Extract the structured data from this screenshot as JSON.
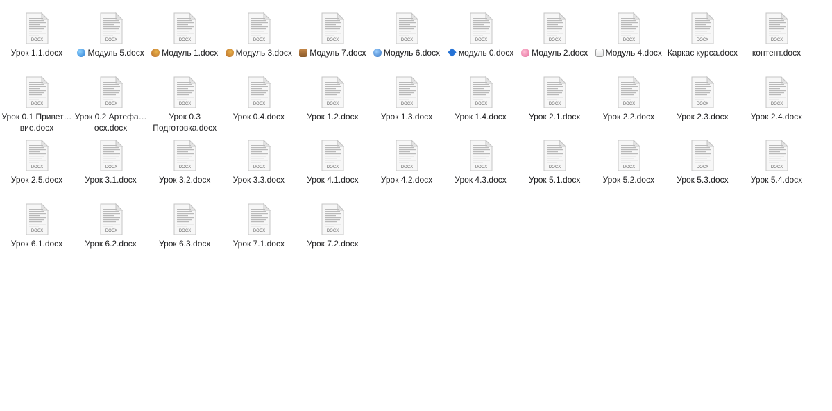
{
  "files": [
    {
      "name": "Урок 1.1.docx",
      "ext": "DOCX"
    },
    {
      "name": "Модуль 5.docx",
      "ext": "DOCX",
      "tag": "globe-icon"
    },
    {
      "name": "Модуль 1.docx",
      "ext": "DOCX",
      "tag": "palette-icon"
    },
    {
      "name": "Модуль 3.docx",
      "ext": "DOCX",
      "tag": "palette-icon"
    },
    {
      "name": "Модуль 7.docx",
      "ext": "DOCX",
      "tag": "box-icon"
    },
    {
      "name": "Модуль 6.docx",
      "ext": "DOCX",
      "tag": "refresh-icon"
    },
    {
      "name": "модуль 0.docx",
      "ext": "DOCX",
      "tag": "blue-diamond-icon"
    },
    {
      "name": "Модуль 2.docx",
      "ext": "DOCX",
      "tag": "brain-icon"
    },
    {
      "name": "Модуль 4.docx",
      "ext": "DOCX",
      "tag": "notepad-icon"
    },
    {
      "name": "Каркас курса.docx",
      "ext": "DOCX"
    },
    {
      "name": "контент.docx",
      "ext": "DOCX"
    },
    {
      "name": "Урок 0.1 Привет…вие.docx",
      "ext": "DOCX"
    },
    {
      "name": "Урок 0.2 Артефа…осх.docx",
      "ext": "DOCX"
    },
    {
      "name": "Урок 0.3 Подготовка.docx",
      "ext": "DOCX"
    },
    {
      "name": "Урок 0.4.docx",
      "ext": "DOCX"
    },
    {
      "name": "Урок 1.2.docx",
      "ext": "DOCX"
    },
    {
      "name": "Урок 1.3.docx",
      "ext": "DOCX"
    },
    {
      "name": "Урок 1.4.docx",
      "ext": "DOCX"
    },
    {
      "name": "Урок 2.1.docx",
      "ext": "DOCX"
    },
    {
      "name": "Урок 2.2.docx",
      "ext": "DOCX"
    },
    {
      "name": "Урок 2.3.docx",
      "ext": "DOCX"
    },
    {
      "name": "Урок 2.4.docx",
      "ext": "DOCX"
    },
    {
      "name": "Урок 2.5.docx",
      "ext": "DOCX"
    },
    {
      "name": "Урок 3.1.docx",
      "ext": "DOCX"
    },
    {
      "name": "Урок 3.2.docx",
      "ext": "DOCX"
    },
    {
      "name": "Урок 3.3.docx",
      "ext": "DOCX"
    },
    {
      "name": "Урок 4.1.docx",
      "ext": "DOCX"
    },
    {
      "name": "Урок 4.2.docx",
      "ext": "DOCX"
    },
    {
      "name": "Урок 4.3.docx",
      "ext": "DOCX"
    },
    {
      "name": "Урок 5.1.docx",
      "ext": "DOCX"
    },
    {
      "name": "Урок 5.2.docx",
      "ext": "DOCX"
    },
    {
      "name": "Урок 5.3.docx",
      "ext": "DOCX"
    },
    {
      "name": "Урок 5.4.docx",
      "ext": "DOCX"
    },
    {
      "name": "Урок 6.1.docx",
      "ext": "DOCX"
    },
    {
      "name": "Урок 6.2.docx",
      "ext": "DOCX"
    },
    {
      "name": "Урок 6.3.docx",
      "ext": "DOCX"
    },
    {
      "name": "Урок 7.1.docx",
      "ext": "DOCX"
    },
    {
      "name": "Урок 7.2.docx",
      "ext": "DOCX"
    }
  ]
}
